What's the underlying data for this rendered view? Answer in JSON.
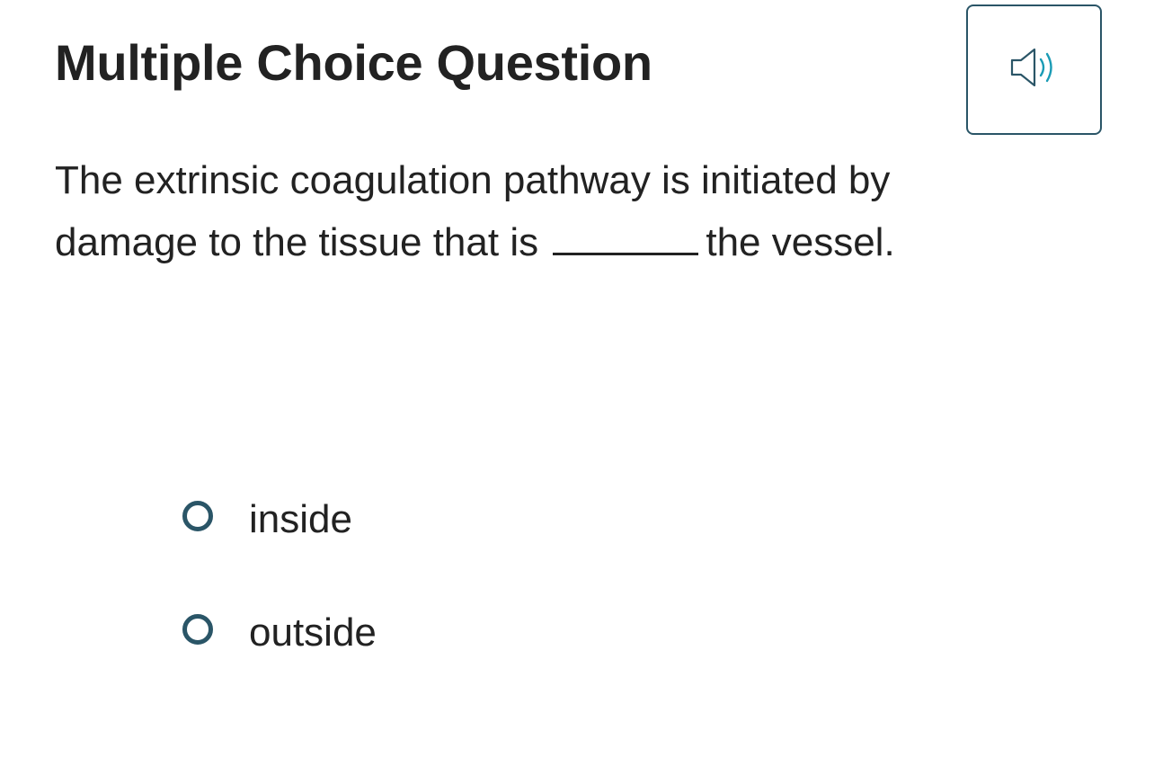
{
  "header": {
    "title": "Multiple Choice Question",
    "audio_icon": "speaker-icon",
    "audio_color": "#1a9bb5",
    "border_color": "#2a5567"
  },
  "question": {
    "text_before": "The extrinsic coagulation pathway is initiated by damage to the tissue that is",
    "text_after": "the vessel."
  },
  "options": [
    {
      "label": "inside",
      "selected": false
    },
    {
      "label": "outside",
      "selected": false
    }
  ]
}
